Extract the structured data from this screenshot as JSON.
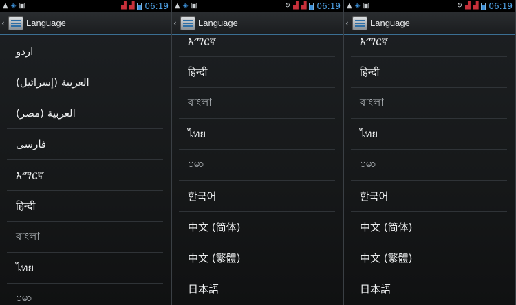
{
  "panels": [
    {
      "status": {
        "time": "06:19"
      },
      "actionbar": {
        "title": "Language"
      },
      "languages": [
        "اردو",
        "العربية (إسرائيل)",
        "العربية (مصر)",
        "فارسی",
        "አማርኛ",
        "हिन्दी",
        "বাংলা",
        "ไทย",
        "ဗမာ"
      ]
    },
    {
      "status": {
        "time": "06:19"
      },
      "actionbar": {
        "title": "Language"
      },
      "languages": [
        "አማርኛ",
        "हिन्दी",
        "বাংলা",
        "ไทย",
        "ဗမာ",
        "한국어",
        "中文 (简体)",
        "中文 (繁體)",
        "日本語"
      ]
    },
    {
      "status": {
        "time": "06:19"
      },
      "actionbar": {
        "title": "Language"
      },
      "languages": [
        "አማርኛ",
        "हिन्दी",
        "বাংলা",
        "ไทย",
        "ဗမာ",
        "한국어",
        "中文 (简体)",
        "中文 (繁體)",
        "日本語"
      ]
    }
  ],
  "icons": {
    "warning": "warning-icon",
    "shield": "shield-icon",
    "image": "image-icon",
    "sync": "sync-icon",
    "signal": "signal-icon",
    "battery": "battery-icon",
    "back": "back-chevron-icon",
    "settings": "settings-app-icon"
  },
  "colors": {
    "accent": "#3b8fd7",
    "divider": "#2f3337",
    "text": "#eceeef"
  }
}
